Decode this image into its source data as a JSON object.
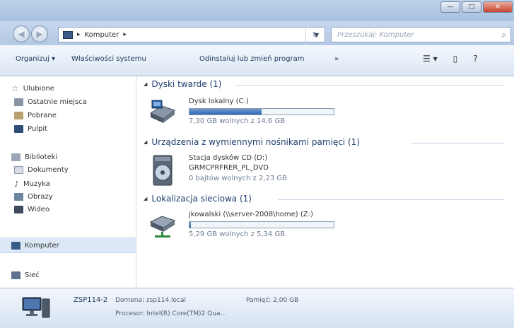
{
  "window": {
    "caption_buttons": [
      "—",
      "□",
      "✕"
    ]
  },
  "address_bar": {
    "path": [
      "Komputer"
    ],
    "search_placeholder": "Przeszukaj: Komputer"
  },
  "toolbar": {
    "organize": "Organizuj ▾",
    "system_properties": "Właściwości systemu",
    "uninstall": "Odinstaluj lub zmień program",
    "more": "»",
    "views": "☰ ▾",
    "preview": "▯",
    "help": "?"
  },
  "sidebar": {
    "favorites": {
      "label": "Ulubione",
      "items": [
        "Ostatnie miejsca",
        "Pobrane",
        "Pulpit"
      ]
    },
    "libraries": {
      "label": "Biblioteki",
      "items": [
        "Dokumenty",
        "Muzyka",
        "Obrazy",
        "Wideo"
      ]
    },
    "computer": "Komputer",
    "network": "Sieć"
  },
  "groups": [
    {
      "title": "Dyski twarde (1)",
      "drives": [
        {
          "name": "Dysk lokalny (C:)",
          "free": "7,30 GB wolnych z 14,6 GB",
          "used_fraction": 0.5
        }
      ]
    },
    {
      "title": "Urządzenia z wymiennymi nośnikami pamięci (1)",
      "drives": [
        {
          "name": "Stacja dysków CD (D:)",
          "label": "GRMCPRFRER_PL_DVD",
          "free": "0 bajtów wolnych z 2,23 GB"
        }
      ]
    },
    {
      "title": "Lokalizacja sieciowa (1)",
      "drives": [
        {
          "name": "jkowalski (\\\\server-2008\\home) (Z:)",
          "free": "5,29 GB wolnych z 5,34 GB",
          "used_fraction": 0.01
        }
      ]
    }
  ],
  "details": {
    "computer_name": "ZSP114-2",
    "domain": "Domena: zsp114.local",
    "memory": "Pamięć: 2,00 GB",
    "processor": "Procesor: Intel(R) Core(TM)2 Qua..."
  },
  "colors": {
    "accent": "#2f67b1",
    "selection": "#dce8f6",
    "group_title": "#1e3f6e"
  }
}
